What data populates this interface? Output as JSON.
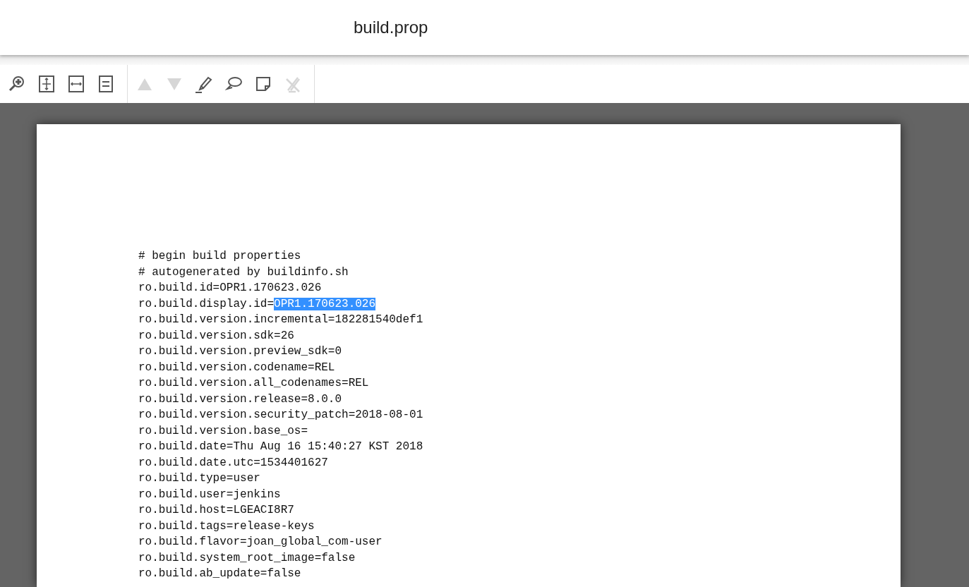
{
  "window": {
    "title": "build.prop"
  },
  "toolbar": {
    "groups": [
      {
        "buttons": [
          {
            "kind": "zoom-in",
            "disabled": false
          },
          {
            "kind": "fit-page",
            "disabled": false
          },
          {
            "kind": "fit-width",
            "disabled": false
          },
          {
            "kind": "single-page",
            "disabled": false
          }
        ]
      },
      {
        "buttons": [
          {
            "kind": "previous",
            "disabled": true
          },
          {
            "kind": "next",
            "disabled": true
          },
          {
            "kind": "highlight",
            "disabled": false
          },
          {
            "kind": "comment",
            "disabled": false
          },
          {
            "kind": "note",
            "disabled": false
          },
          {
            "kind": "erase",
            "disabled": true
          }
        ]
      }
    ]
  },
  "document": {
    "lines": [
      {
        "parts": [
          {
            "text": "# begin build properties",
            "selected": false
          }
        ]
      },
      {
        "parts": [
          {
            "text": "# autogenerated by buildinfo.sh",
            "selected": false
          }
        ]
      },
      {
        "parts": [
          {
            "text": "ro.build.id=OPR1.170623.026",
            "selected": false
          }
        ]
      },
      {
        "parts": [
          {
            "text": "ro.build.display.id=",
            "selected": false
          },
          {
            "text": "OPR1.170623.026",
            "selected": true
          }
        ]
      },
      {
        "parts": [
          {
            "text": "ro.build.version.incremental=182281540def1",
            "selected": false
          }
        ]
      },
      {
        "parts": [
          {
            "text": "ro.build.version.sdk=26",
            "selected": false
          }
        ]
      },
      {
        "parts": [
          {
            "text": "ro.build.version.preview_sdk=0",
            "selected": false
          }
        ]
      },
      {
        "parts": [
          {
            "text": "ro.build.version.codename=REL",
            "selected": false
          }
        ]
      },
      {
        "parts": [
          {
            "text": "ro.build.version.all_codenames=REL",
            "selected": false
          }
        ]
      },
      {
        "parts": [
          {
            "text": "ro.build.version.release=8.0.0",
            "selected": false
          }
        ]
      },
      {
        "parts": [
          {
            "text": "ro.build.version.security_patch=2018-08-01",
            "selected": false
          }
        ]
      },
      {
        "parts": [
          {
            "text": "ro.build.version.base_os=",
            "selected": false
          }
        ]
      },
      {
        "parts": [
          {
            "text": "ro.build.date=Thu Aug 16 15:40:27 KST 2018",
            "selected": false
          }
        ]
      },
      {
        "parts": [
          {
            "text": "ro.build.date.utc=1534401627",
            "selected": false
          }
        ]
      },
      {
        "parts": [
          {
            "text": "ro.build.type=user",
            "selected": false
          }
        ]
      },
      {
        "parts": [
          {
            "text": "ro.build.user=jenkins",
            "selected": false
          }
        ]
      },
      {
        "parts": [
          {
            "text": "ro.build.host=LGEACI8R7",
            "selected": false
          }
        ]
      },
      {
        "parts": [
          {
            "text": "ro.build.tags=release-keys",
            "selected": false
          }
        ]
      },
      {
        "parts": [
          {
            "text": "ro.build.flavor=joan_global_com-user",
            "selected": false
          }
        ]
      },
      {
        "parts": [
          {
            "text": "ro.build.system_root_image=false",
            "selected": false
          }
        ]
      },
      {
        "parts": [
          {
            "text": "ro.build.ab_update=false",
            "selected": false
          }
        ]
      }
    ]
  }
}
